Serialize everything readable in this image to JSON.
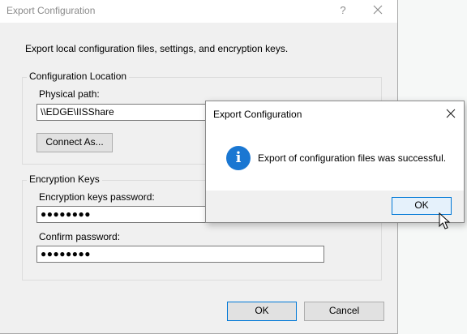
{
  "dialog": {
    "title": "Export Configuration",
    "help_label": "?",
    "description": "Export local configuration files, settings, and encryption keys.",
    "location_group": {
      "title": "Configuration Location",
      "path_label": "Physical path:",
      "path_value": "\\\\EDGE\\IISShare",
      "connect_label": "Connect As..."
    },
    "encryption_group": {
      "title": "Encryption Keys",
      "password_label": "Encryption keys password:",
      "password_mask": "●●●●●●●●",
      "confirm_label": "Confirm password:",
      "confirm_mask": "●●●●●●●●"
    },
    "ok_label": "OK",
    "cancel_label": "Cancel"
  },
  "message_box": {
    "title": "Export Configuration",
    "icon": "info-icon",
    "message": "Export of configuration files was successful.",
    "ok_label": "OK"
  },
  "colors": {
    "accent": "#0078d7",
    "info_icon": "#1a77d2"
  }
}
